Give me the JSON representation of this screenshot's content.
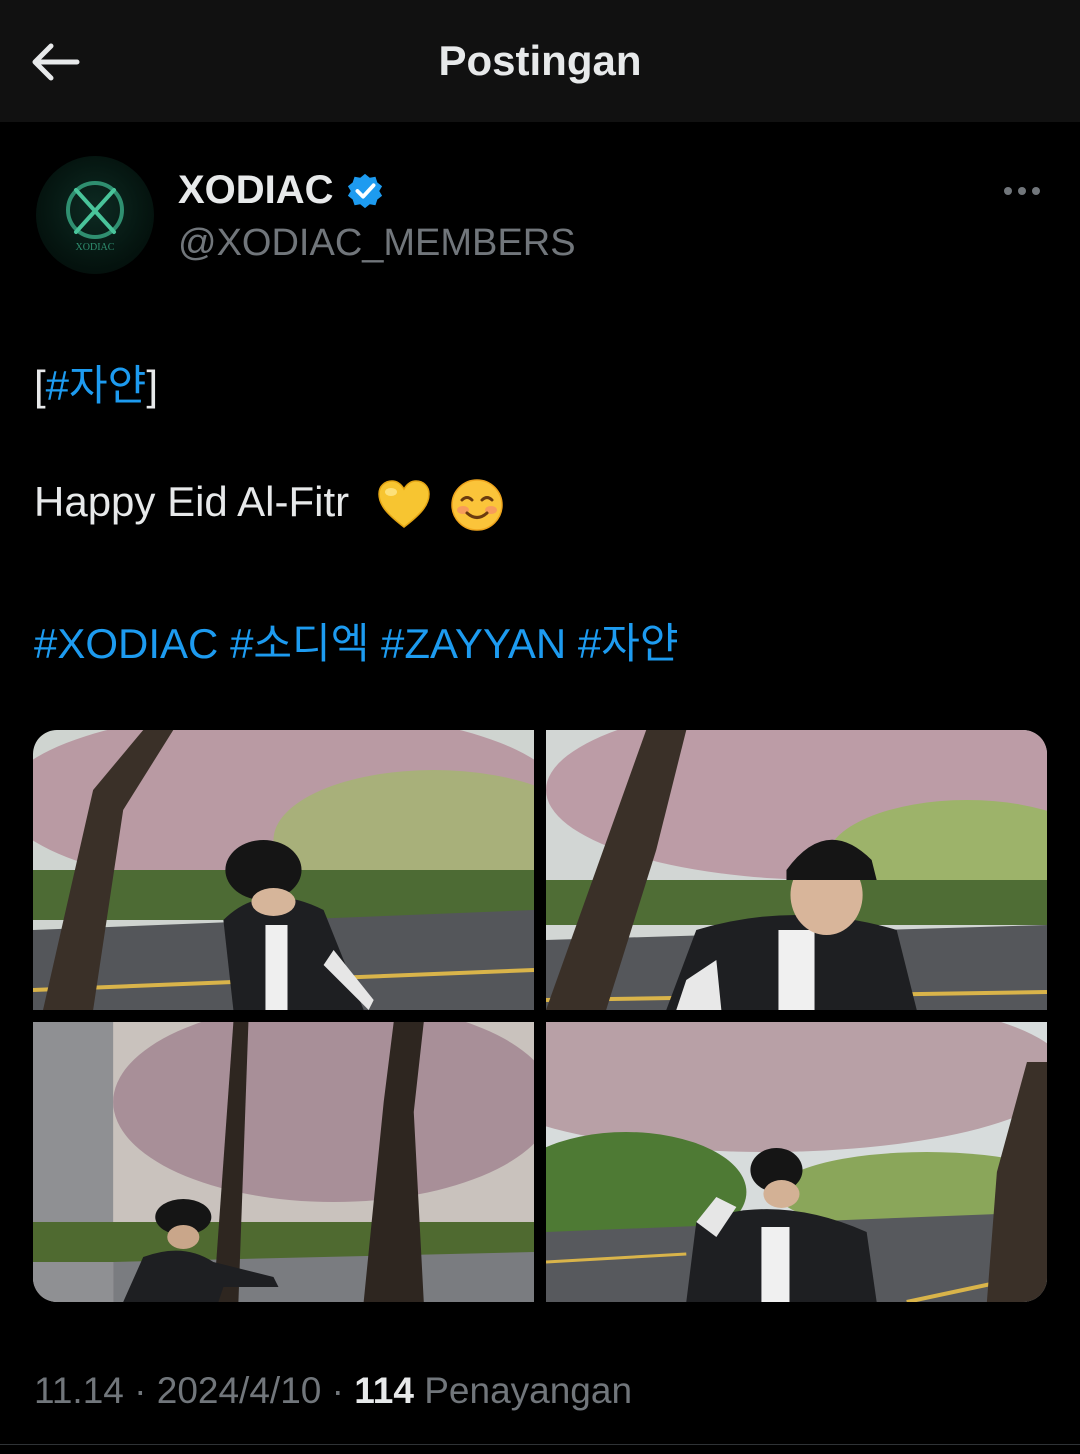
{
  "header": {
    "title": "Postingan"
  },
  "author": {
    "name": "XODIAC",
    "handle": "@XODIAC_MEMBERS",
    "verified": true,
    "avatar_text": "XODIAC"
  },
  "post": {
    "tag_line": {
      "open": "[",
      "tag": "#자얀",
      "close": "]"
    },
    "message": "Happy Eid Al-Fitr",
    "emojis": [
      "yellow-heart",
      "smiling-face"
    ],
    "hashtags": [
      "#XODIAC",
      "#소디엑",
      "#ZAYYAN",
      "#자얀"
    ],
    "photos_count": 4
  },
  "meta": {
    "time": "11.14",
    "separator": " · ",
    "date": "2024/4/10",
    "views": "114",
    "views_label": "Penayangan"
  },
  "colors": {
    "link": "#1d9bf0",
    "secondary": "#71767b",
    "background": "#000000",
    "header": "#111111"
  }
}
